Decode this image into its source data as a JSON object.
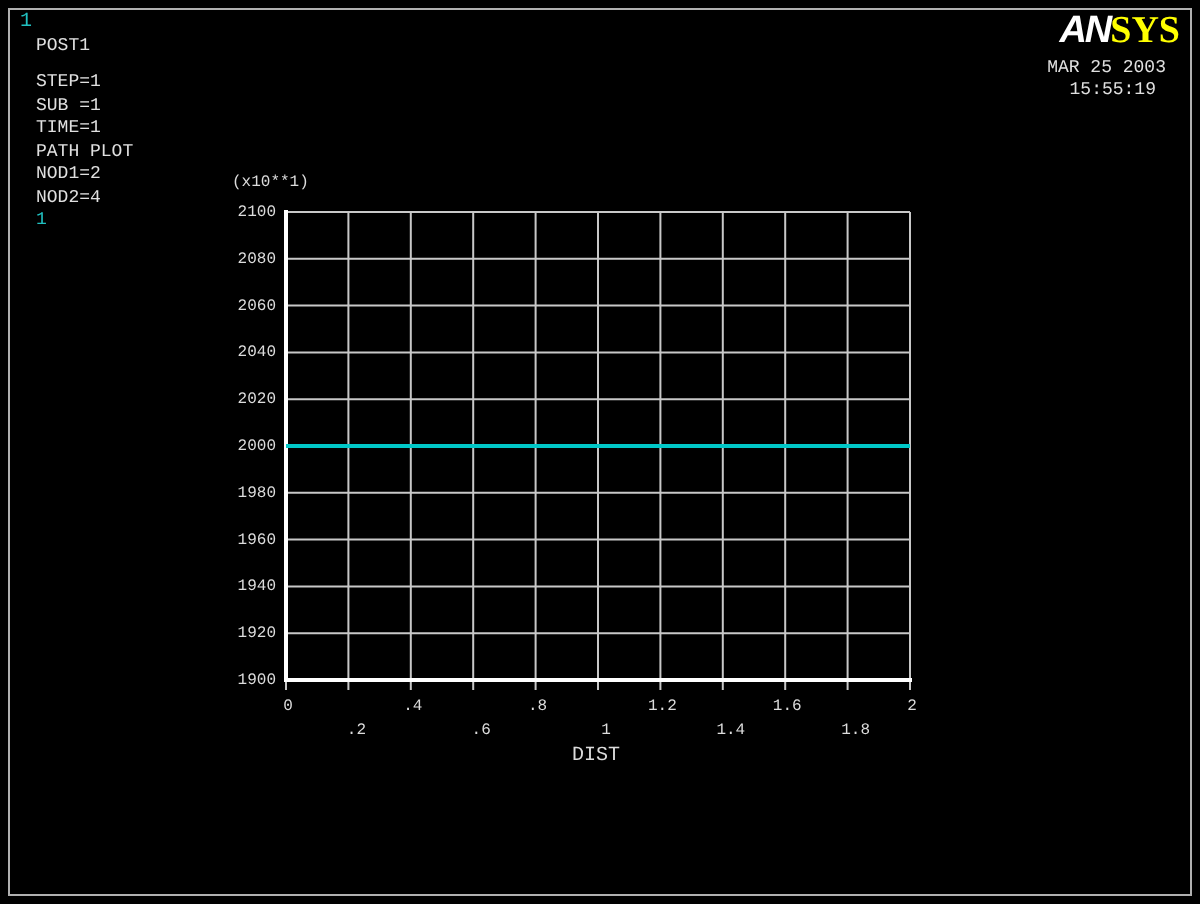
{
  "window": {
    "number": "1"
  },
  "info_lines": [
    {
      "kind": "title",
      "text": "POST1"
    },
    {
      "kind": "text",
      "text": "STEP=1"
    },
    {
      "kind": "text",
      "text": "SUB =1"
    },
    {
      "kind": "text",
      "text": "TIME=1"
    },
    {
      "kind": "text",
      "text": "PATH PLOT"
    },
    {
      "kind": "text",
      "text": "NOD1=2"
    },
    {
      "kind": "text",
      "text": "NOD2=4"
    },
    {
      "kind": "number",
      "text": "1"
    }
  ],
  "logo": {
    "parts": [
      {
        "text": "AN",
        "color": "#ffffff"
      },
      {
        "text": "SYS",
        "color": "#ffff00"
      }
    ]
  },
  "date": "MAR 25 2003",
  "time": "15:55:19",
  "plot": {
    "multiplier": "(x10**1)",
    "chart_data": {
      "type": "line",
      "xlabel": "DIST",
      "x": [
        0,
        2
      ],
      "series": [
        {
          "color": "#00c8c8",
          "values": [
            2000,
            2000
          ]
        }
      ],
      "grid": true,
      "xlim": [
        0,
        2
      ],
      "ylim": [
        1900,
        2100
      ],
      "xticks": [
        0,
        {
          "value": 0.4,
          "label": ".4"
        },
        {
          "value": 0.8,
          "label": ".8"
        },
        1.2,
        1.6,
        2
      ],
      "annotations": [
        ".2",
        ".6",
        "1",
        "1.4",
        "1.8"
      ],
      "yticks": [
        1900,
        1920,
        1940,
        1960,
        1980,
        2000,
        2020,
        2040,
        2060,
        2080,
        2100
      ]
    }
  }
}
